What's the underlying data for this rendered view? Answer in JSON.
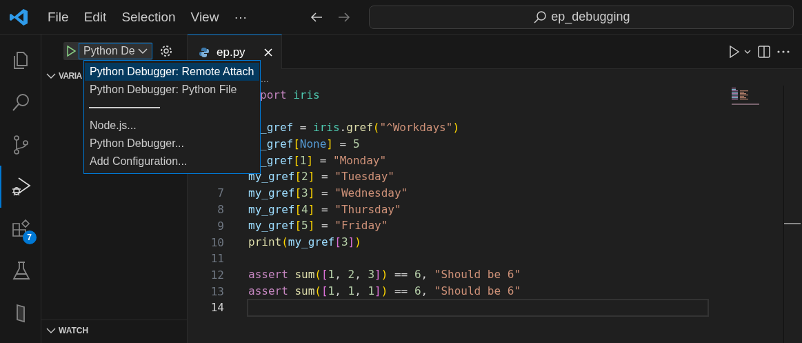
{
  "title_bar": {
    "menu": [
      "File",
      "Edit",
      "Selection",
      "View"
    ],
    "more": "···",
    "search": "ep_debugging"
  },
  "activity_bar": [
    {
      "kind": "files",
      "selected": false
    },
    {
      "kind": "search",
      "selected": false
    },
    {
      "kind": "branch",
      "selected": false
    },
    {
      "kind": "debug",
      "selected": true
    },
    {
      "kind": "extensions",
      "selected": false,
      "badge": "7"
    },
    {
      "kind": "flask",
      "selected": false
    },
    {
      "kind": "panel",
      "selected": false
    }
  ],
  "sidebar": {
    "config": "Python De",
    "sections": [
      {
        "title": "VARIA",
        "expanded": true
      },
      {
        "title": "WATCH",
        "expanded": true
      }
    ]
  },
  "dropdown": [
    {
      "kind": "option",
      "label": "Python Debugger: Remote Attach",
      "selected": true
    },
    {
      "kind": "option",
      "label": "Python Debugger: Python File",
      "selected": false
    },
    {
      "kind": "separator"
    },
    {
      "kind": "option",
      "label": "Node.js...",
      "selected": false
    },
    {
      "kind": "option",
      "label": "Python Debugger...",
      "selected": false
    },
    {
      "kind": "option",
      "label": "Add Configuration...",
      "selected": false
    }
  ],
  "tabs": [
    {
      "label": "ep.py",
      "selected": true
    }
  ],
  "editor": {
    "breadcrumb": "...",
    "lines": [
      {
        "covered": true,
        "current": false,
        "tokens": [
          {
            "text": "port",
            "kind": "keyword"
          },
          {
            "text": " iris",
            "kind": "module"
          }
        ]
      },
      {
        "current": false
      },
      {
        "covered": true,
        "current": false,
        "tokens": [
          {
            "text": "_gref",
            "kind": "variable"
          },
          {
            "text": " = ",
            "kind": "plain"
          },
          {
            "text": "iris",
            "kind": "module"
          },
          {
            "text": ".",
            "kind": "plain"
          },
          {
            "text": "gref",
            "kind": "function"
          },
          {
            "text": "(",
            "kind": "bracket1"
          },
          {
            "text": "\"^Workdays\"",
            "kind": "string"
          },
          {
            "text": ")",
            "kind": "bracket1"
          }
        ]
      },
      {
        "covered": true,
        "current": false,
        "tokens": [
          {
            "text": "_gref",
            "kind": "variable"
          },
          {
            "text": "[",
            "kind": "bracket1"
          },
          {
            "text": "None",
            "kind": "constant"
          },
          {
            "text": "]",
            "kind": "bracket1"
          },
          {
            "text": " = ",
            "kind": "plain"
          },
          {
            "text": "5",
            "kind": "number"
          }
        ]
      },
      {
        "covered": true,
        "current": false,
        "tokens": [
          {
            "text": "_gref",
            "kind": "variable"
          },
          {
            "text": "[",
            "kind": "bracket1"
          },
          {
            "text": "1",
            "kind": "number"
          },
          {
            "text": "]",
            "kind": "bracket1"
          },
          {
            "text": " = ",
            "kind": "plain"
          },
          {
            "text": "\"Monday\"",
            "kind": "string"
          }
        ]
      },
      {
        "covered": false,
        "current": false,
        "tokens": [
          {
            "text": "my_gref",
            "kind": "variable"
          },
          {
            "text": "[",
            "kind": "bracket1"
          },
          {
            "text": "2",
            "kind": "number"
          },
          {
            "text": "]",
            "kind": "bracket1"
          },
          {
            "text": " = ",
            "kind": "plain"
          },
          {
            "text": "\"Tuesday\"",
            "kind": "string"
          }
        ]
      },
      {
        "number": "7",
        "covered": false,
        "current": false,
        "tokens": [
          {
            "text": "my_gref",
            "kind": "variable"
          },
          {
            "text": "[",
            "kind": "bracket1"
          },
          {
            "text": "3",
            "kind": "number"
          },
          {
            "text": "]",
            "kind": "bracket1"
          },
          {
            "text": " = ",
            "kind": "plain"
          },
          {
            "text": "\"Wednesday\"",
            "kind": "string"
          }
        ]
      },
      {
        "number": "8",
        "covered": false,
        "current": false,
        "tokens": [
          {
            "text": "my_gref",
            "kind": "variable"
          },
          {
            "text": "[",
            "kind": "bracket1"
          },
          {
            "text": "4",
            "kind": "number"
          },
          {
            "text": "]",
            "kind": "bracket1"
          },
          {
            "text": " = ",
            "kind": "plain"
          },
          {
            "text": "\"Thursday\"",
            "kind": "string"
          }
        ]
      },
      {
        "number": "9",
        "covered": false,
        "current": false,
        "tokens": [
          {
            "text": "my_gref",
            "kind": "variable"
          },
          {
            "text": "[",
            "kind": "bracket1"
          },
          {
            "text": "5",
            "kind": "number"
          },
          {
            "text": "]",
            "kind": "bracket1"
          },
          {
            "text": " = ",
            "kind": "plain"
          },
          {
            "text": "\"Friday\"",
            "kind": "string"
          }
        ]
      },
      {
        "number": "10",
        "covered": false,
        "current": false,
        "tokens": [
          {
            "text": "print",
            "kind": "function"
          },
          {
            "text": "(",
            "kind": "bracket1"
          },
          {
            "text": "my_gref",
            "kind": "variable"
          },
          {
            "text": "[",
            "kind": "bracket2"
          },
          {
            "text": "3",
            "kind": "number"
          },
          {
            "text": "]",
            "kind": "bracket2"
          },
          {
            "text": ")",
            "kind": "bracket1"
          }
        ]
      },
      {
        "number": "11",
        "current": false
      },
      {
        "number": "12",
        "covered": false,
        "current": false,
        "tokens": [
          {
            "text": "assert",
            "kind": "keyword"
          },
          {
            "text": " sum",
            "kind": "function"
          },
          {
            "text": "(",
            "kind": "bracket1"
          },
          {
            "text": "[",
            "kind": "bracket2"
          },
          {
            "text": "1",
            "kind": "number"
          },
          {
            "text": ", ",
            "kind": "plain"
          },
          {
            "text": "2",
            "kind": "number"
          },
          {
            "text": ", ",
            "kind": "plain"
          },
          {
            "text": "3",
            "kind": "number"
          },
          {
            "text": "]",
            "kind": "bracket2"
          },
          {
            "text": ")",
            "kind": "bracket1"
          },
          {
            "text": " == ",
            "kind": "plain"
          },
          {
            "text": "6",
            "kind": "number"
          },
          {
            "text": ", ",
            "kind": "plain"
          },
          {
            "text": "\"Should be 6\"",
            "kind": "string"
          }
        ]
      },
      {
        "number": "13",
        "covered": false,
        "current": false,
        "tokens": [
          {
            "text": "assert",
            "kind": "keyword"
          },
          {
            "text": " sum",
            "kind": "function"
          },
          {
            "text": "(",
            "kind": "bracket1"
          },
          {
            "text": "[",
            "kind": "bracket2"
          },
          {
            "text": "1",
            "kind": "number"
          },
          {
            "text": ", ",
            "kind": "plain"
          },
          {
            "text": "1",
            "kind": "number"
          },
          {
            "text": ", ",
            "kind": "plain"
          },
          {
            "text": "1",
            "kind": "number"
          },
          {
            "text": "]",
            "kind": "bracket2"
          },
          {
            "text": ")",
            "kind": "bracket1"
          },
          {
            "text": " == ",
            "kind": "plain"
          },
          {
            "text": "6",
            "kind": "number"
          },
          {
            "text": ", ",
            "kind": "plain"
          },
          {
            "text": "\"Should be 6\"",
            "kind": "string"
          }
        ]
      },
      {
        "number": "14",
        "covered": false,
        "current": true
      }
    ]
  }
}
